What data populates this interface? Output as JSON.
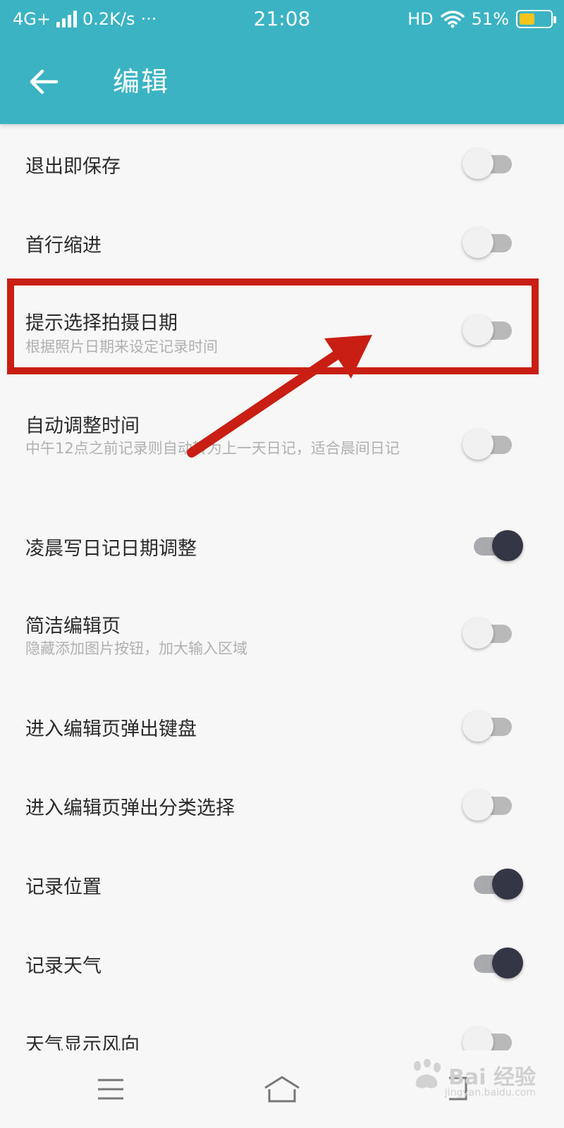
{
  "status_bar": {
    "network": "4G+",
    "speed": "0.2K/s",
    "more": "···",
    "time": "21:08",
    "hd": "HD",
    "battery_percent": "51%",
    "battery_level": 0.51
  },
  "header": {
    "title": "编辑",
    "back_icon": "arrow-left-icon"
  },
  "settings": [
    {
      "title": "退出即保存",
      "subtitle": "",
      "on": false
    },
    {
      "title": "首行缩进",
      "subtitle": "",
      "on": false
    },
    {
      "title": "提示选择拍摄日期",
      "subtitle": "根据照片日期来设定记录时间",
      "on": false
    },
    {
      "title": "自动调整时间",
      "subtitle": "中午12点之前记录则自动转为上一天日记，适合晨间日记",
      "on": false
    },
    {
      "title": "凌晨写日记日期调整",
      "subtitle": "",
      "on": true
    },
    {
      "title": "简洁编辑页",
      "subtitle": "隐藏添加图片按钮，加大输入区域",
      "on": false
    },
    {
      "title": "进入编辑页弹出键盘",
      "subtitle": "",
      "on": false
    },
    {
      "title": "进入编辑页弹出分类选择",
      "subtitle": "",
      "on": false
    },
    {
      "title": "记录位置",
      "subtitle": "",
      "on": true
    },
    {
      "title": "记录天气",
      "subtitle": "",
      "on": true
    },
    {
      "title": "天气显示风向",
      "subtitle": "",
      "on": false
    }
  ],
  "annotation": {
    "color": "#c81e14"
  },
  "nav_bar": {
    "icons": [
      "menu-icon",
      "home-icon",
      "back-icon"
    ]
  },
  "watermark": {
    "logo_text": "Bai 经验",
    "url": "jingyan.baidu.com"
  },
  "colors": {
    "header": "#3bb3c3",
    "toggle_on_knob": "#343646",
    "background": "#f7f7f7"
  }
}
